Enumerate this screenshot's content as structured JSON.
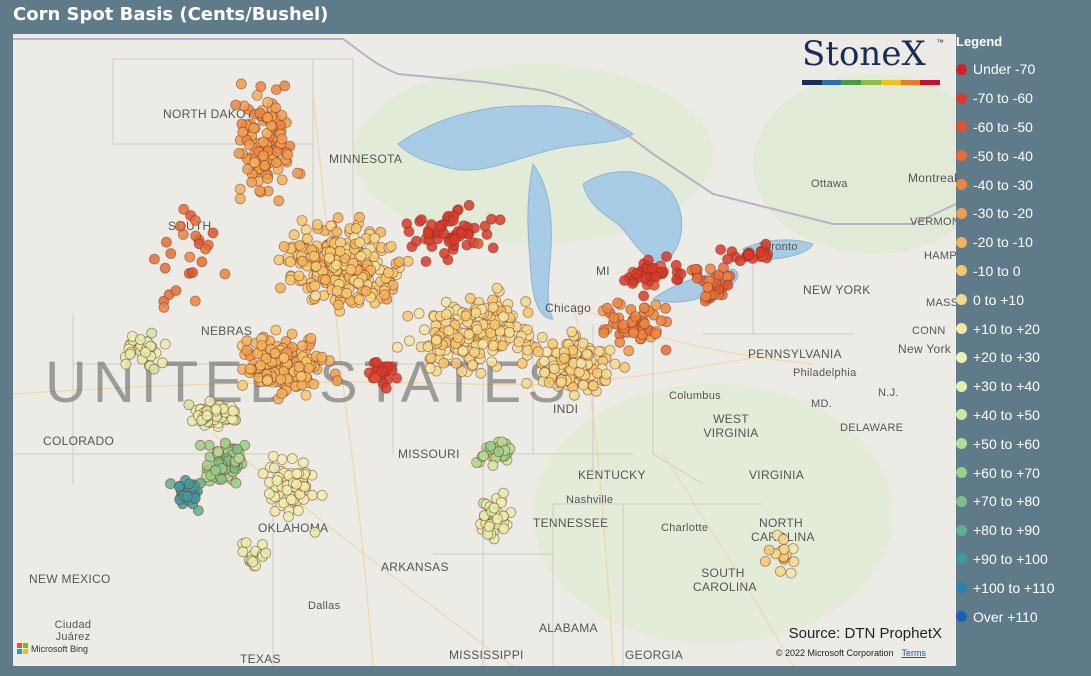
{
  "title": "Corn Spot Basis (Cents/Bushel)",
  "logo": {
    "text": "StoneX",
    "tm": "™",
    "bar_colors": [
      "#1a2d5a",
      "#2a6db0",
      "#4a9b3f",
      "#8cbf3f",
      "#f1c21b",
      "#e77b1e",
      "#c8102e"
    ]
  },
  "legend": {
    "title": "Legend",
    "items": [
      {
        "label": "Under -70",
        "color": "#d0202a"
      },
      {
        "label": "-70 to -60",
        "color": "#d93a2c"
      },
      {
        "label": "-60 to -50",
        "color": "#e0532f"
      },
      {
        "label": "-50 to -40",
        "color": "#e66c35"
      },
      {
        "label": "-40 to -30",
        "color": "#ec8540"
      },
      {
        "label": "-30 to -20",
        "color": "#f09c4c"
      },
      {
        "label": "-20 to -10",
        "color": "#f3b25a"
      },
      {
        "label": "-10 to 0",
        "color": "#f6c86d"
      },
      {
        "label": "0 to +10",
        "color": "#f4d98a"
      },
      {
        "label": "+10 to +20",
        "color": "#f2e7a6"
      },
      {
        "label": "+20 to +30",
        "color": "#eef0b0"
      },
      {
        "label": "+30 to +40",
        "color": "#e1eeae"
      },
      {
        "label": "+40 to +50",
        "color": "#cde6a2"
      },
      {
        "label": "+50 to +60",
        "color": "#b4dd95"
      },
      {
        "label": "+60 to +70",
        "color": "#97cf8b"
      },
      {
        "label": "+70 to +80",
        "color": "#7cc08a"
      },
      {
        "label": "+80 to +90",
        "color": "#5eaf91"
      },
      {
        "label": "+90 to +100",
        "color": "#3f9aa0"
      },
      {
        "label": "+100 to +110",
        "color": "#2a82b2"
      },
      {
        "label": "Over +110",
        "color": "#1a63b4"
      }
    ]
  },
  "map": {
    "places": [
      {
        "name": "NORTH DAKOTA",
        "kind": "state"
      },
      {
        "name": "MINNESOTA",
        "kind": "state"
      },
      {
        "name": "SOUTH",
        "kind": "state"
      },
      {
        "name": "NEBRAS",
        "kind": "state"
      },
      {
        "name": "UNITED STATES",
        "kind": "country"
      },
      {
        "name": "COLORADO",
        "kind": "state"
      },
      {
        "name": "MISSOURI",
        "kind": "state"
      },
      {
        "name": "KENTUCKY",
        "kind": "state"
      },
      {
        "name": "TENNESSEE",
        "kind": "state"
      },
      {
        "name": "OKLAHOMA",
        "kind": "state"
      },
      {
        "name": "ARKANSAS",
        "kind": "state"
      },
      {
        "name": "NEW MEXICO",
        "kind": "state"
      },
      {
        "name": "TEXAS",
        "kind": "state"
      },
      {
        "name": "ALABAMA",
        "kind": "state"
      },
      {
        "name": "MISSISSIPPI",
        "kind": "state"
      },
      {
        "name": "GEORGIA",
        "kind": "state"
      },
      {
        "name": "SOUTH CAROLINA",
        "kind": "state"
      },
      {
        "name": "NORTH CAROLINA",
        "kind": "state"
      },
      {
        "name": "VIRGINIA",
        "kind": "state"
      },
      {
        "name": "WEST VIRGINIA",
        "kind": "state"
      },
      {
        "name": "PENNSYLVANIA",
        "kind": "state"
      },
      {
        "name": "NEW YORK",
        "kind": "state"
      },
      {
        "name": "VERMONT",
        "kind": "state"
      },
      {
        "name": "HAMP",
        "kind": "state"
      },
      {
        "name": "MASS",
        "kind": "state"
      },
      {
        "name": "CONN",
        "kind": "state"
      },
      {
        "name": "N.J.",
        "kind": "state"
      },
      {
        "name": "MD.",
        "kind": "state"
      },
      {
        "name": "DELAWARE",
        "kind": "state"
      },
      {
        "name": "MI",
        "kind": "state"
      },
      {
        "name": "INDI",
        "kind": "state"
      },
      {
        "name": "Chicago",
        "kind": "city"
      },
      {
        "name": "Toronto",
        "kind": "city"
      },
      {
        "name": "Ottawa",
        "kind": "city"
      },
      {
        "name": "Montreal",
        "kind": "city"
      },
      {
        "name": "New York",
        "kind": "city"
      },
      {
        "name": "Philadelphia",
        "kind": "city"
      },
      {
        "name": "Columbus",
        "kind": "city"
      },
      {
        "name": "Nashville",
        "kind": "city"
      },
      {
        "name": "Charlotte",
        "kind": "city"
      },
      {
        "name": "Dallas",
        "kind": "city"
      },
      {
        "name": "Ciudad Juárez",
        "kind": "city"
      }
    ],
    "source": "Source: DTN ProphetX",
    "copyright": "© 2022 Microsoft Corporation",
    "terms": "Terms",
    "bing": "Microsoft Bing"
  }
}
